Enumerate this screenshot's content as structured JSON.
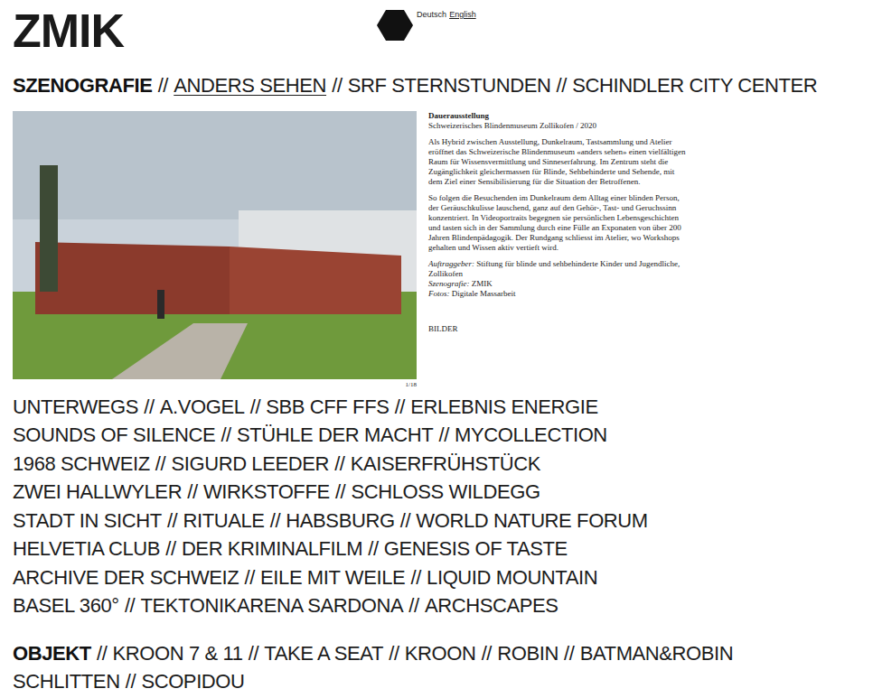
{
  "logo": "ZMIK",
  "languages": [
    {
      "label": "Deutsch",
      "selected": true
    },
    {
      "label": "English",
      "selected": false
    }
  ],
  "separator": "//",
  "szenografie": {
    "title": "SZENOGRAFIE",
    "top_items": [
      {
        "label": "ANDERS SEHEN",
        "selected": true
      },
      {
        "label": "SRF STERNSTUNDEN",
        "selected": false
      },
      {
        "label": "SCHINDLER CITY CENTER",
        "selected": false
      }
    ],
    "detail": {
      "heading": "Dauerausstellung",
      "subtitle": "Schweizerisches Blindenmuseum Zollikofen / 2020",
      "paragraphs": [
        "Als Hybrid zwischen Ausstellung, Dunkelraum, Tastsammlung und Atelier eröffnet das Schweizerische Blindenmuseum «anders sehen» einen vielfältigen Raum für Wissensvermittlung und Sinneserfahrung. Im Zentrum steht die Zugänglichkeit gleichermassen für Blinde, Sehbehinderte und Sehende, mit dem Ziel einer Sensibilisierung für die Situation der Betroffenen.",
        "So folgen die Besuchenden im Dunkelraum dem Alltag einer blinden Person, der Geräuschkulisse lauschend, ganz auf den Gehör-, Tast- und Geruchssinn konzentriert. In Videoportraits begegnen sie persönlichen Lebensgeschichten und tasten sich in der Sammlung durch eine Fülle an Exponaten von über 200 Jahren Blindenpädagogik. Der Rundgang schliesst im Atelier, wo Workshops gehalten und Wissen aktiv vertieft wird."
      ],
      "credits": [
        {
          "label": "Auftraggeber:",
          "value": "Stiftung für blinde und sehbehinderte Kinder und Jugendliche, Zollikofen"
        },
        {
          "label": "Szenografie:",
          "value": "ZMIK"
        },
        {
          "label": "Fotos:",
          "value": "Digitale Massarbeit"
        }
      ],
      "link": "BILDER",
      "counter": "1/18"
    },
    "rows": [
      [
        {
          "label": "UNTERWEGS",
          "selected": false
        },
        {
          "label": "A.VOGEL",
          "selected": false
        },
        {
          "label": "SBB CFF FFS",
          "selected": false
        },
        {
          "label": "ERLEBNIS ENERGIE",
          "selected": false
        }
      ],
      [
        {
          "label": "SOUNDS OF SILENCE",
          "selected": false
        },
        {
          "label": "STÜHLE DER MACHT",
          "selected": false
        },
        {
          "label": "MYCOLLECTION",
          "selected": false
        }
      ],
      [
        {
          "label": "1968 SCHWEIZ",
          "selected": false
        },
        {
          "label": "SIGURD LEEDER",
          "selected": false
        },
        {
          "label": "KAISERFRÜHSTÜCK",
          "selected": false
        }
      ],
      [
        {
          "label": "ZWEI HALLWYLER",
          "selected": false
        },
        {
          "label": "WIRKSTOFFE",
          "selected": false
        },
        {
          "label": "SCHLOSS WILDEGG",
          "selected": false
        }
      ],
      [
        {
          "label": "STADT IN SICHT",
          "selected": false
        },
        {
          "label": "RITUALE",
          "selected": false
        },
        {
          "label": "HABSBURG",
          "selected": false
        },
        {
          "label": "WORLD NATURE FORUM",
          "selected": false
        }
      ],
      [
        {
          "label": "HELVETIA CLUB",
          "selected": false
        },
        {
          "label": "DER KRIMINALFILM",
          "selected": false
        },
        {
          "label": "GENESIS OF TASTE",
          "selected": false
        }
      ],
      [
        {
          "label": "ARCHIVE DER SCHWEIZ",
          "selected": false
        },
        {
          "label": "EILE MIT WEILE",
          "selected": false
        },
        {
          "label": "LIQUID MOUNTAIN",
          "selected": false
        }
      ],
      [
        {
          "label": "BASEL 360°",
          "selected": false
        },
        {
          "label": "TEKTONIKARENA SARDONA",
          "selected": false
        },
        {
          "label": "ARCHSCAPES",
          "selected": false
        }
      ]
    ]
  },
  "objekt": {
    "title": "OBJEKT",
    "rows": [
      [
        {
          "label": "KROON 7 & 11",
          "selected": false
        },
        {
          "label": "TAKE A SEAT",
          "selected": false
        },
        {
          "label": "KROON",
          "selected": false
        },
        {
          "label": "ROBIN",
          "selected": false
        },
        {
          "label": "BATMAN&ROBIN",
          "selected": false
        }
      ],
      [
        {
          "label": "SCHLITTEN",
          "selected": false
        },
        {
          "label": "SCOPIDOU",
          "selected": false
        }
      ]
    ]
  }
}
